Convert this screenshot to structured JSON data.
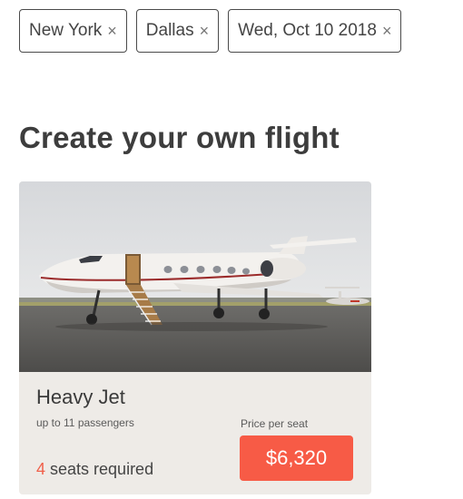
{
  "filters": [
    {
      "label": "New York",
      "remove_icon": "close-icon",
      "remove_glyph": "×"
    },
    {
      "label": "Dallas",
      "remove_icon": "close-icon",
      "remove_glyph": "×"
    },
    {
      "label": "Wed, Oct 10 2018",
      "remove_icon": "close-icon",
      "remove_glyph": "×"
    }
  ],
  "section_title": "Create your own flight",
  "card": {
    "image_subject": "private jet on tarmac",
    "name": "Heavy Jet",
    "capacity": "up to 11 passengers",
    "seats_count": "4",
    "seats_text": " seats required",
    "price_label": "Price per seat",
    "price": "$6,320"
  },
  "colors": {
    "accent": "#f75b46",
    "seats_count": "#f0604a",
    "card_background": "#eeebe7",
    "text": "#3a3a3a"
  }
}
